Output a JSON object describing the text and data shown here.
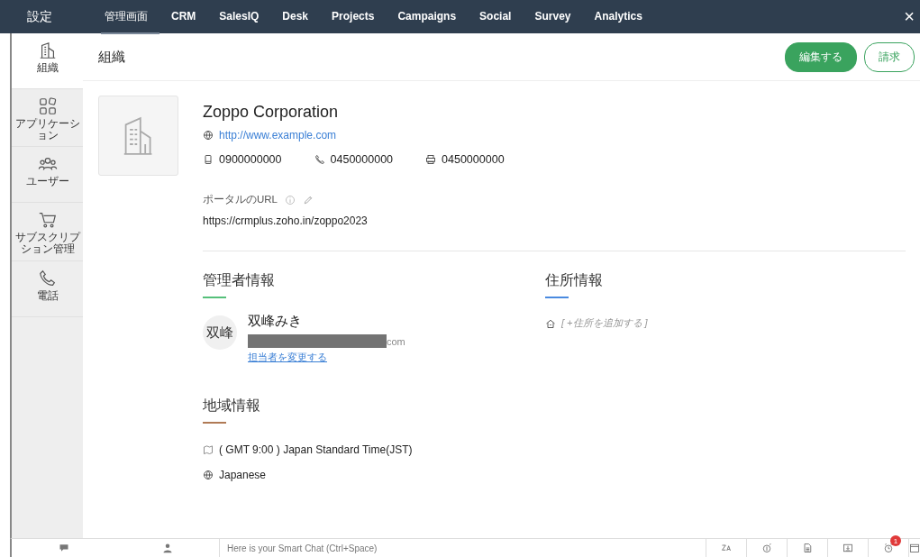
{
  "topbar": {
    "title": "設定",
    "tabs": [
      {
        "label": "管理画面",
        "selected": true
      },
      {
        "label": "CRM",
        "selected": false
      },
      {
        "label": "SalesIQ",
        "selected": false
      },
      {
        "label": "Desk",
        "selected": false
      },
      {
        "label": "Projects",
        "selected": false
      },
      {
        "label": "Campaigns",
        "selected": false
      },
      {
        "label": "Social",
        "selected": false
      },
      {
        "label": "Survey",
        "selected": false
      },
      {
        "label": "Analytics",
        "selected": false
      }
    ],
    "close": "×"
  },
  "sidebar": {
    "items": [
      {
        "label": "組織",
        "kind": "building",
        "selected": true
      },
      {
        "label": "アプリケーション",
        "kind": "apps",
        "selected": false
      },
      {
        "label": "ユーザー",
        "kind": "users",
        "selected": false
      },
      {
        "label": "サブスクリプション管理",
        "kind": "cart",
        "selected": false
      },
      {
        "label": "電話",
        "kind": "phone",
        "selected": false
      }
    ]
  },
  "header": {
    "title": "組織",
    "buttons": [
      {
        "label": "編集する",
        "kind": "primary"
      },
      {
        "label": "請求",
        "kind": "outline"
      }
    ]
  },
  "organization": {
    "name": "Zoppo Corporation",
    "website": "http://www.example.com",
    "contacts": [
      {
        "kind": "mobile",
        "value": "0900000000"
      },
      {
        "kind": "phone",
        "value": "0450000000"
      },
      {
        "kind": "fax",
        "value": "0450000000"
      }
    ],
    "portal_label": "ポータルのURL",
    "portal_url": "https://crmplus.zoho.in/zoppo2023"
  },
  "admin": {
    "heading": "管理者情報",
    "avatar": "双峰",
    "name": "双峰みき",
    "email_visible": "com",
    "change_link": "担当者を変更する"
  },
  "address": {
    "heading": "住所情報",
    "add_link": "[ +住所を追加する ]"
  },
  "region": {
    "heading": "地域情報",
    "timezone": "( GMT 9:00 ) Japan Standard Time(JST)",
    "language": "Japanese"
  },
  "bottombar": {
    "placeholder": "Here is your Smart Chat (Ctrl+Space)",
    "badge": "1"
  }
}
